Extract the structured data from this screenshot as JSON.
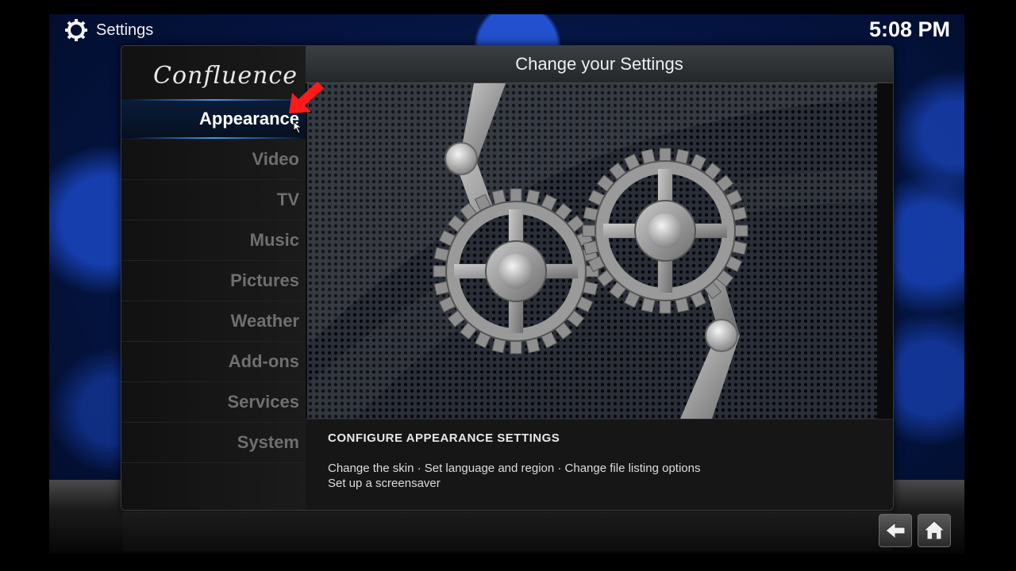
{
  "app_title": "Settings",
  "clock": "5:08 PM",
  "logo_text": "Confluence",
  "dialog": {
    "header_title": "Change your Settings",
    "close_label": "×"
  },
  "menu": [
    {
      "label": "Appearance",
      "active": true
    },
    {
      "label": "Video"
    },
    {
      "label": "TV"
    },
    {
      "label": "Music"
    },
    {
      "label": "Pictures"
    },
    {
      "label": "Weather"
    },
    {
      "label": "Add-ons"
    },
    {
      "label": "Services"
    },
    {
      "label": "System"
    }
  ],
  "description": {
    "heading": "CONFIGURE APPEARANCE SETTINGS",
    "line1": "Change the skin · Set language and region · Change file listing options",
    "line2": "Set up a screensaver"
  },
  "icons": {
    "gear": "gear-icon",
    "back": "back-arrow-icon",
    "home": "home-icon",
    "pointer": "red-arrow-icon",
    "cursor": "mouse-cursor-icon"
  },
  "colors": {
    "accent": "#3a7bff",
    "active_text": "#ffffff",
    "inactive_text": "#6f6f6f"
  }
}
